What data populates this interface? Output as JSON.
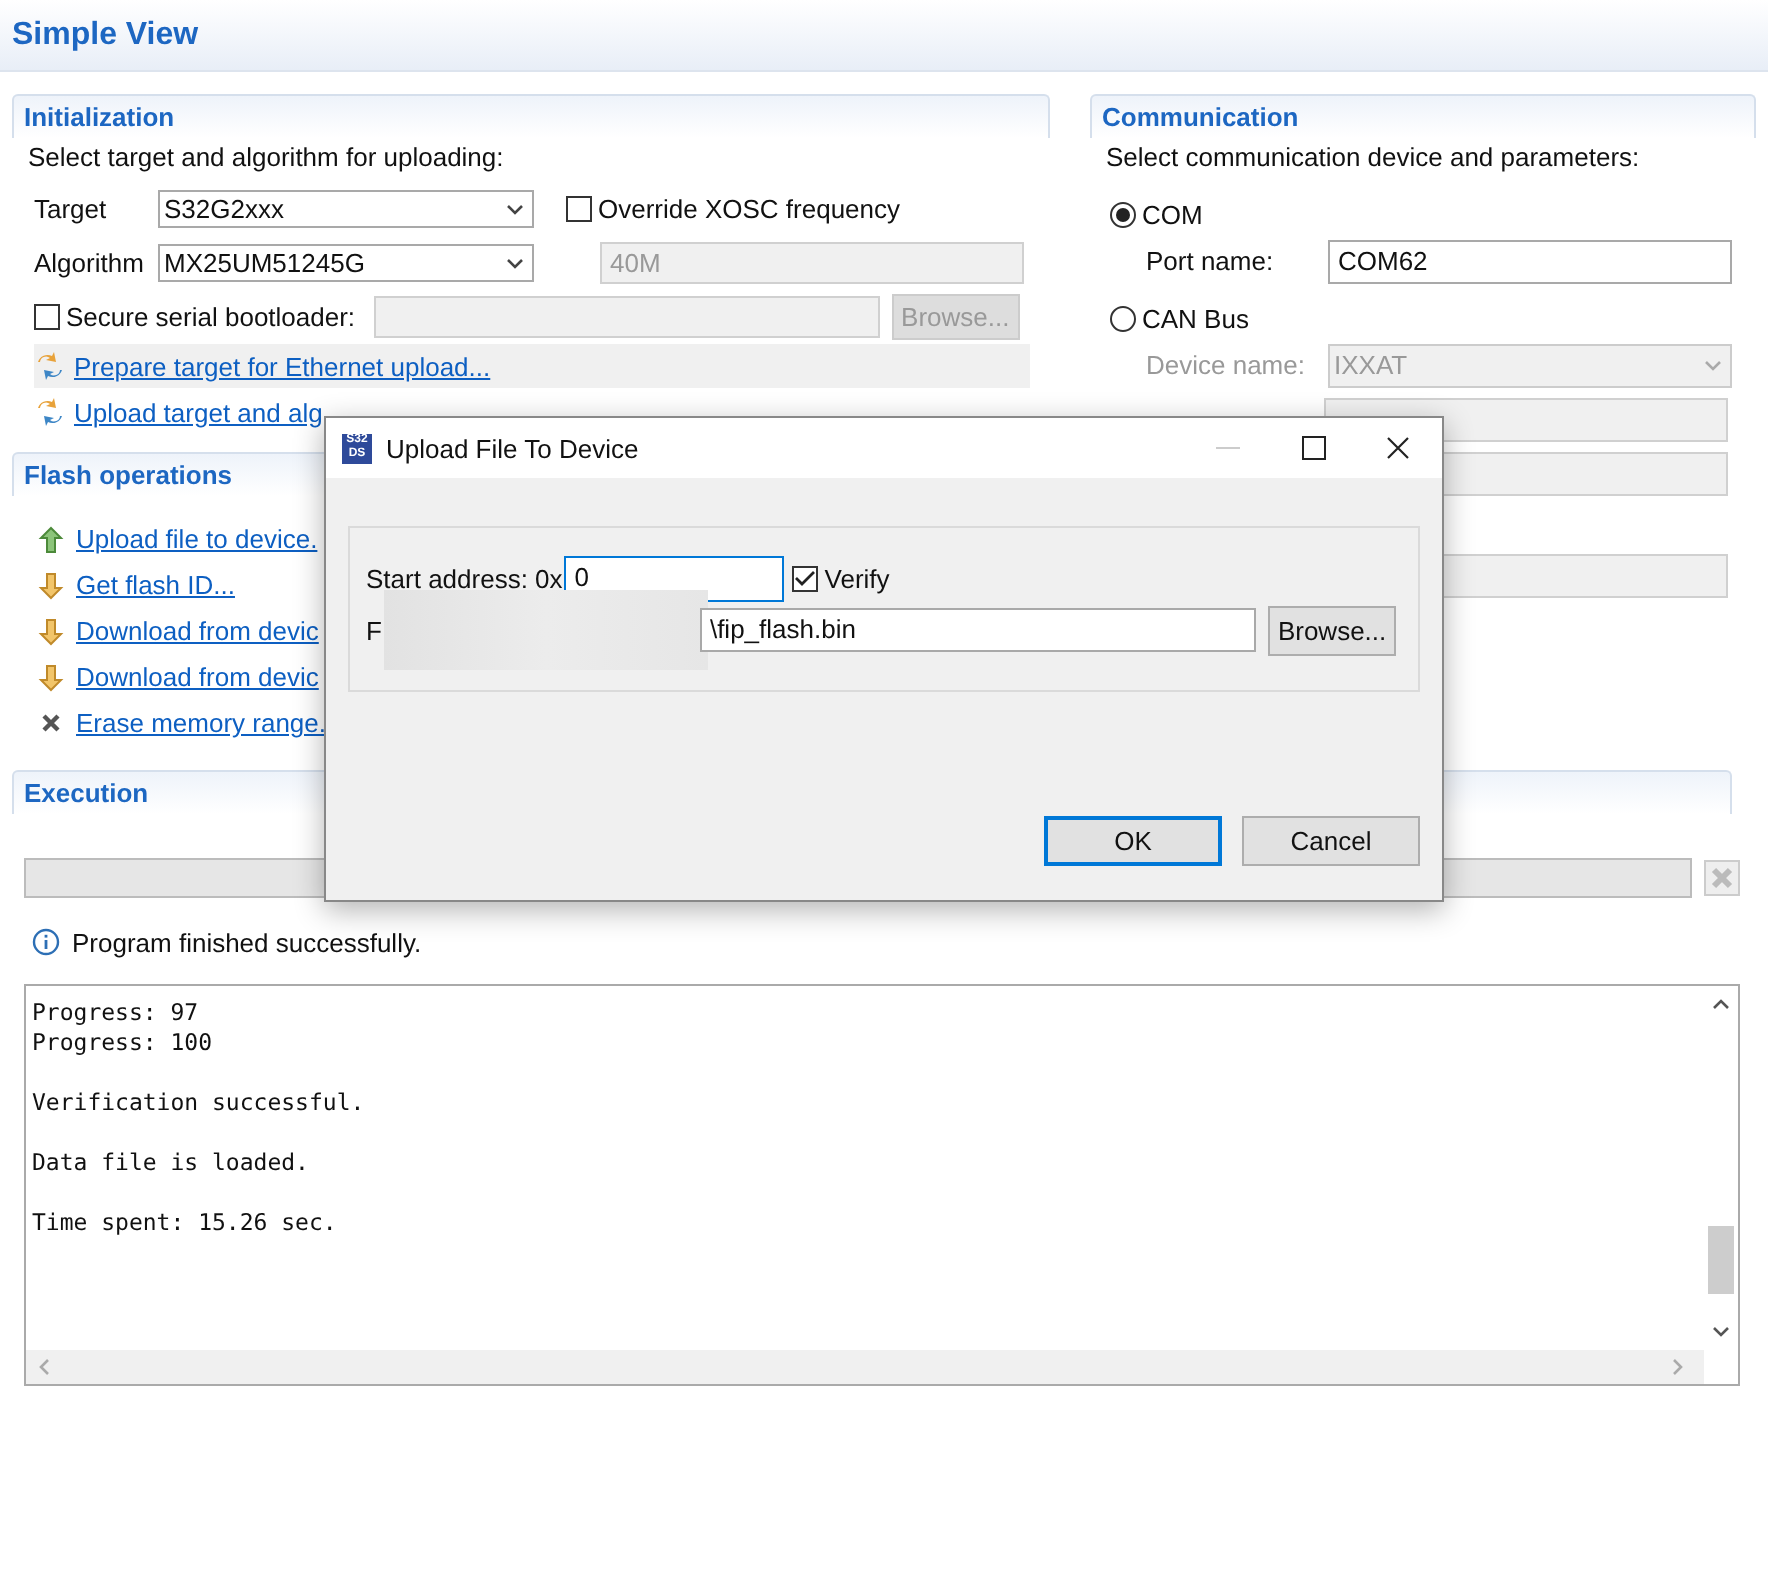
{
  "header": {
    "title": "Simple View"
  },
  "initialization": {
    "title": "Initialization",
    "description": "Select target and algorithm for uploading:",
    "target": {
      "label": "Target",
      "value": "S32G2xxx"
    },
    "algorithm": {
      "label": "Algorithm",
      "value": "MX25UM51245G"
    },
    "override_xosc": {
      "label": "Override XOSC frequency",
      "checked": false
    },
    "xosc_frequency": {
      "value": "40M",
      "disabled": true
    },
    "secure_bootloader": {
      "label": "Secure serial bootloader:",
      "checked": false
    },
    "browse_button": {
      "label": "Browse...",
      "disabled": true
    },
    "links": [
      {
        "label": "Prepare target for Ethernet upload...",
        "selected": true
      },
      {
        "label": "Upload target and alg",
        "selected": false
      }
    ]
  },
  "flash_operations": {
    "title": "Flash operations",
    "links": [
      {
        "label": "Upload file to device.",
        "kind": "upload"
      },
      {
        "label": "Get flash ID...",
        "kind": "download"
      },
      {
        "label": "Download from devic",
        "kind": "download"
      },
      {
        "label": "Download from devic",
        "kind": "download"
      },
      {
        "label": "Erase memory range.",
        "kind": "erase"
      }
    ]
  },
  "communication": {
    "title": "Communication",
    "description": "Select communication device and parameters:",
    "options": [
      {
        "label": "COM",
        "selected": true,
        "fields": [
          {
            "label": "Port name:",
            "value": "COM62",
            "kind": "input"
          }
        ]
      },
      {
        "label": "CAN Bus",
        "selected": false,
        "fields": [
          {
            "label": "Device name:",
            "value": "IXXAT",
            "kind": "select"
          },
          {
            "kind": "input"
          },
          {
            "kind": "input"
          },
          {
            "kind": "input_spaced"
          }
        ]
      }
    ]
  },
  "execution": {
    "title": "Execution",
    "progress": {
      "level": 0
    },
    "stop_button": {
      "disabled": true
    },
    "status": "Program finished successfully.",
    "console_blocks": [
      [
        "Progress: 97",
        "Progress: 100"
      ],
      [
        "Verification successful."
      ],
      [
        "Data file is loaded."
      ],
      [
        "Time spent: 15.26 sec."
      ]
    ]
  },
  "dialog": {
    "title": "Upload File To Device",
    "icon_label": [
      "S32",
      "DS"
    ],
    "start_address": {
      "label": "Start address: 0x",
      "value": "0"
    },
    "verify": {
      "label": "Verify",
      "checked": true
    },
    "file": {
      "label": "F",
      "value": "\\fip_flash.bin"
    },
    "browse": "Browse...",
    "buttons": [
      {
        "label": "OK",
        "default": true
      },
      {
        "label": "Cancel",
        "default": false
      }
    ]
  }
}
